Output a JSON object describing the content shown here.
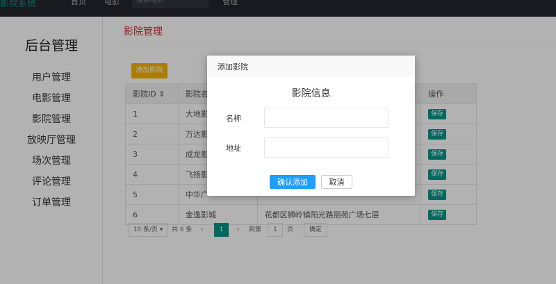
{
  "topbar": {
    "logo": "影院系统",
    "nav": [
      "首页",
      "电影"
    ],
    "search_placeholder": "搜索电影",
    "manage": "管理"
  },
  "sidebar": {
    "title": "后台管理",
    "items": [
      "用户管理",
      "电影管理",
      "影院管理",
      "放映厅管理",
      "场次管理",
      "评论管理",
      "订单管理"
    ]
  },
  "main": {
    "page_title": "影院管理",
    "add_button": "添加影院",
    "table": {
      "headers": [
        "影院ID ⇕",
        "影院名",
        "",
        "操作"
      ],
      "rows": [
        {
          "id": "1",
          "name": "大地影",
          "addr": "",
          "action": "保存"
        },
        {
          "id": "2",
          "name": "万达影",
          "addr": "",
          "action": "保存"
        },
        {
          "id": "3",
          "name": "成龙影",
          "addr": "",
          "action": "保存"
        },
        {
          "id": "4",
          "name": "飞扬影",
          "addr": "",
          "action": "保存"
        },
        {
          "id": "5",
          "name": "中华广",
          "addr": "",
          "action": "保存"
        },
        {
          "id": "6",
          "name": "金逸影城",
          "addr": "花都区狮岭镇阳光路丽苑广场七层",
          "action": "保存"
        }
      ]
    },
    "pager": {
      "per_page": "10 条/页 ▾",
      "total": "共 6 条",
      "prev": "‹",
      "current": "1",
      "next": "›",
      "goto": "到第",
      "page_input": "1",
      "page_unit": "页",
      "confirm": "确定"
    }
  },
  "modal": {
    "header": "添加影院",
    "title": "影院信息",
    "name_label": "名称",
    "address_label": "地址",
    "name_value": "",
    "address_value": "",
    "confirm_button": "确认添加",
    "cancel_button": "取消"
  }
}
